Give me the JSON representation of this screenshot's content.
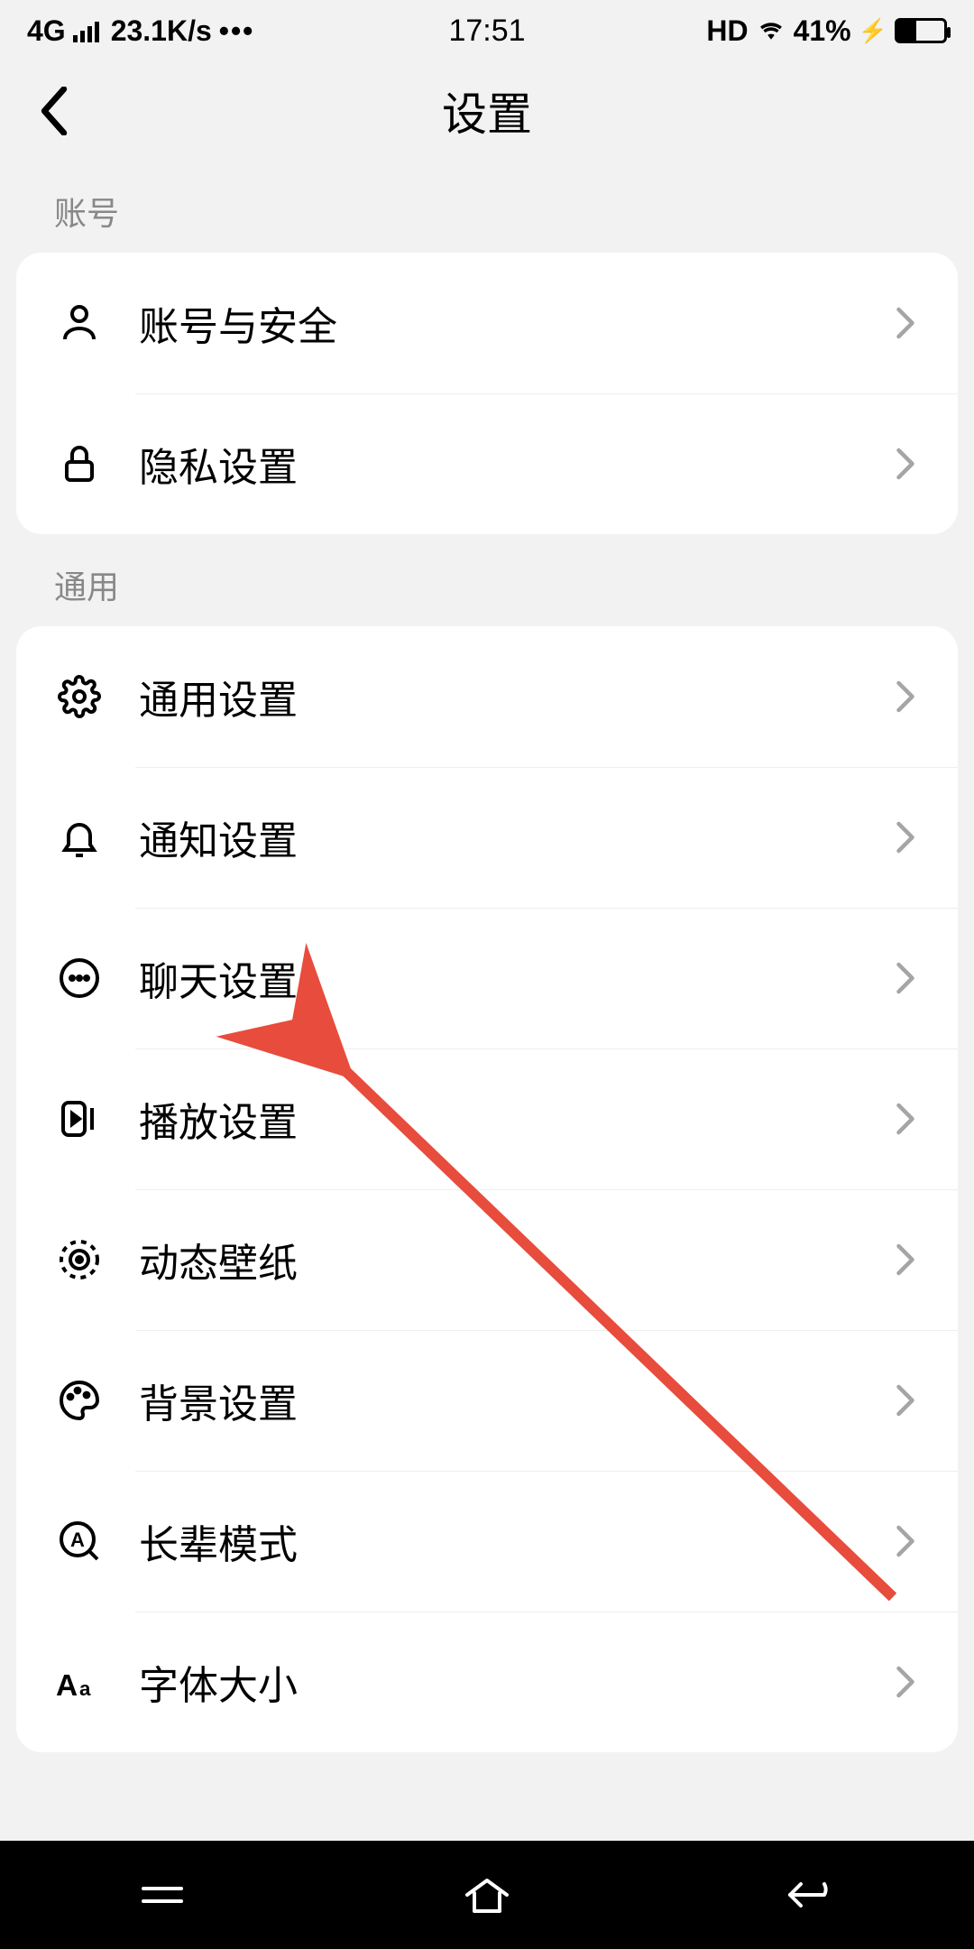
{
  "status": {
    "network": "4G",
    "speed": "23.1K/s",
    "time": "17:51",
    "hd": "HD",
    "battery_pct": "41%"
  },
  "header": {
    "title": "设置"
  },
  "sections": {
    "account": {
      "header": "账号",
      "items": [
        {
          "label": "账号与安全"
        },
        {
          "label": "隐私设置"
        }
      ]
    },
    "general": {
      "header": "通用",
      "items": [
        {
          "label": "通用设置"
        },
        {
          "label": "通知设置"
        },
        {
          "label": "聊天设置"
        },
        {
          "label": "播放设置"
        },
        {
          "label": "动态壁纸"
        },
        {
          "label": "背景设置"
        },
        {
          "label": "长辈模式"
        },
        {
          "label": "字体大小"
        }
      ]
    }
  }
}
